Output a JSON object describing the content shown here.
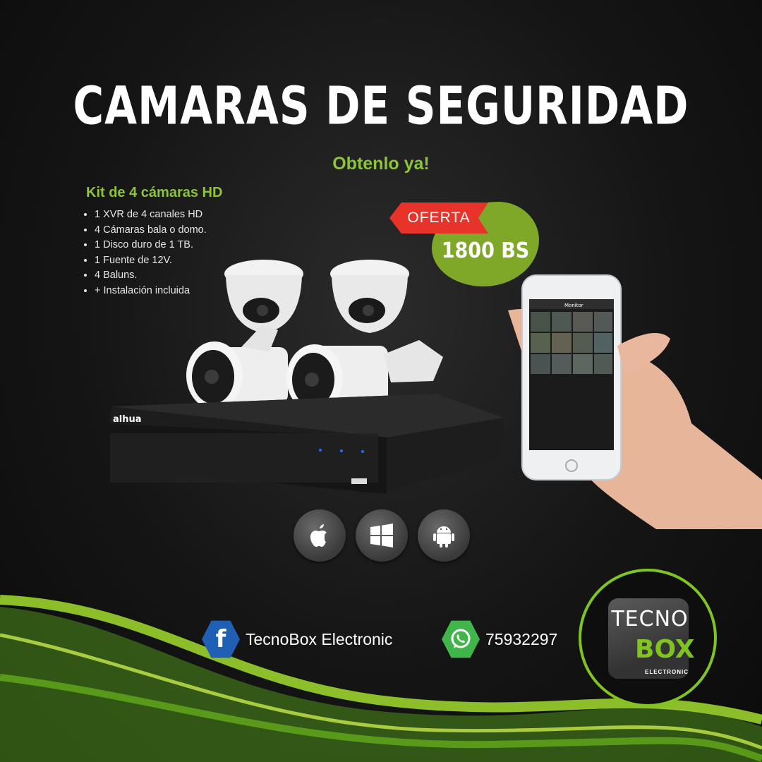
{
  "headline": "CAMARAS DE SEGURIDAD",
  "subheadline": "Obtenlo  ya!",
  "kit": {
    "title": "Kit de 4 cámaras HD",
    "items": [
      "1 XVR de 4 canales HD",
      "4 Cámaras bala o domo.",
      "1 Disco duro de 1 TB.",
      "1 Fuente de 12V.",
      "4 Baluns.",
      "+ Instalación incluida"
    ]
  },
  "offer": {
    "label": "OFERTA",
    "price": "1800 BS"
  },
  "dvr_brand": "alhua",
  "phone_screen_title": "Monitor",
  "platform_icons": [
    "apple-icon",
    "windows-icon",
    "android-icon"
  ],
  "contacts": {
    "facebook": {
      "icon": "facebook-icon",
      "text": "TecnoBox Electronic"
    },
    "whatsapp": {
      "icon": "whatsapp-icon",
      "text": "75932297"
    }
  },
  "logo": {
    "line1": "TECNO",
    "line2": "BOX",
    "line3": "ELECTRONIC"
  },
  "colors": {
    "accent_green": "#8cc43a",
    "offer_red": "#e8332b",
    "offer_green": "#7fa829",
    "facebook_blue": "#1f5fb4",
    "whatsapp_green": "#25d366"
  }
}
